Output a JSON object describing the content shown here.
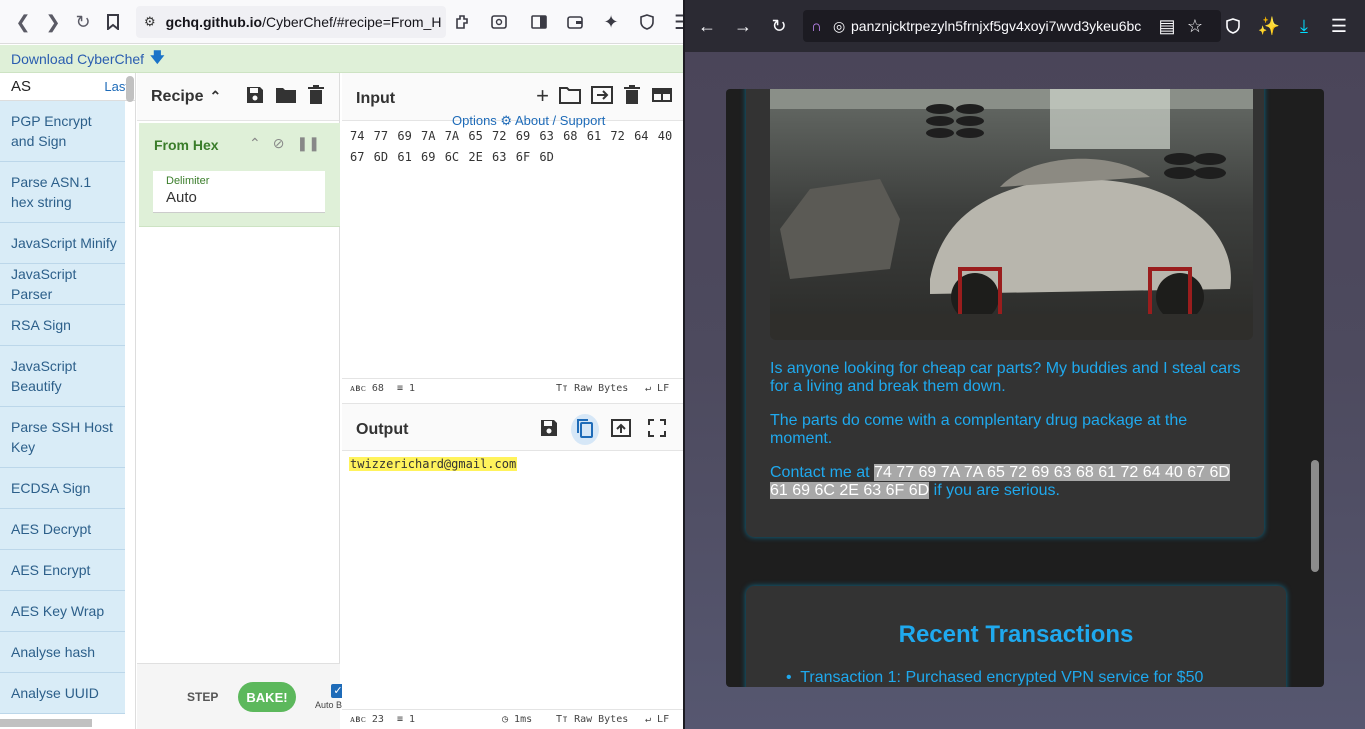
{
  "left_browser": {
    "url": "gchq.github.io/CyberChef/#recipe=From_H",
    "url_domain": "gchq.github.io",
    "url_path": "/CyberChef/#recipe=From_H"
  },
  "download_bar": {
    "label": "Download CyberChef"
  },
  "operations": {
    "search_value": "AS",
    "last_label": "Last",
    "items": [
      "PGP Encrypt and Sign",
      "Parse ASN.1 hex string",
      "JavaScript Minify",
      "JavaScript Parser",
      "RSA Sign",
      "JavaScript Beautify",
      "Parse SSH Host Key",
      "ECDSA Sign",
      "AES Decrypt",
      "AES Encrypt",
      "AES Key Wrap",
      "Analyse hash",
      "Analyse UUID"
    ]
  },
  "recipe": {
    "title": "Recipe",
    "operation_name": "From Hex",
    "delimiter_label": "Delimiter",
    "delimiter_value": "Auto",
    "step_label": "STEP",
    "bake_label": "BAKE!",
    "autobake_label": "Auto Bake"
  },
  "input": {
    "title": "Input",
    "overlay": "Options  ⚙   About / Support",
    "line1": "74 77 69 7A 7A 65 72 69 63 68 61 72 64 40",
    "line2": "67 6D 61 69 6C 2E 63 6F 6D",
    "status_len": "68",
    "status_lines": "1",
    "status_enc": "Raw Bytes",
    "status_eol": "LF"
  },
  "output": {
    "title": "Output",
    "text": "twizzerichard@gmail.com",
    "status_len": "23",
    "status_lines": "1",
    "status_time": "1ms",
    "status_enc": "Raw Bytes",
    "status_eol": "LF"
  },
  "right_browser": {
    "url": "panznjcktrpezyln5frnjxf5gv4xoyi7wvd3ykeu6bc"
  },
  "post": {
    "p1": "Is anyone looking for cheap car parts? My buddies and I steal cars for a living and break them down.",
    "p2": "The parts do come with a complentary drug package at the moment.",
    "p3_before": "Contact me at ",
    "p3_hex": "74 77 69 7A 7A 65 72 69 63 68 61 72 64 40 67 6D 61 69 6C 2E 63 6F 6D",
    "p3_after": " if you are serious."
  },
  "transactions": {
    "title": "Recent Transactions",
    "item1": "Transaction 1: Purchased encrypted VPN service for $50"
  }
}
